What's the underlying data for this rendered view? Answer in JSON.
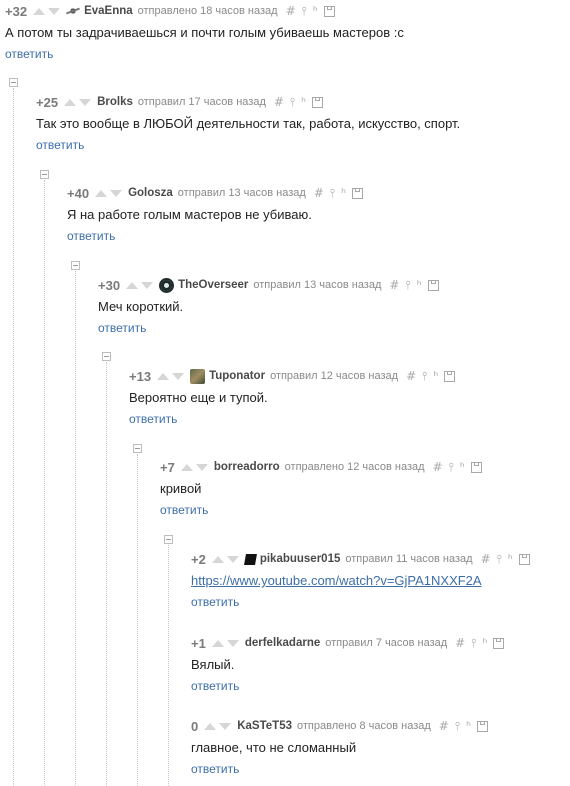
{
  "comments": [
    {
      "rating": "+32",
      "user": "EvaEnna",
      "time": "отправлено 18 часов назад",
      "text": "А потом ты задрачиваешься и почти голым убиваешь мастеров :с",
      "reply": "ответить",
      "avatar": "bug-avatar"
    },
    {
      "rating": "+25",
      "user": "Brolks",
      "time": "отправил 17 часов назад",
      "text": "Так это вообще в ЛЮБОЙ деятельности так, работа, искусство, спорт.",
      "reply": "ответить",
      "avatar": ""
    },
    {
      "rating": "+40",
      "user": "Golosza",
      "time": "отправил 13 часов назад",
      "text": "Я на работе голым мастеров не убиваю.",
      "reply": "ответить",
      "avatar": ""
    },
    {
      "rating": "+30",
      "user": "TheOverseer",
      "time": "отправил 13 часов назад",
      "text": "Меч короткий.",
      "reply": "ответить",
      "avatar": "ring-avatar"
    },
    {
      "rating": "+13",
      "user": "Tuponator",
      "time": "отправил 12 часов назад",
      "text": "Вероятно еще и тупой.",
      "reply": "ответить",
      "avatar": "photo-avatar"
    },
    {
      "rating": "+7",
      "user": "borreadorro",
      "time": "отправлено 12 часов назад",
      "text": "кривой",
      "reply": "ответить",
      "avatar": ""
    },
    {
      "rating": "+2",
      "user": "pikabuuser015",
      "time": "отправил 11 часов назад",
      "text": "https://www.youtube.com/watch?v=GjPA1NXXF2A",
      "reply": "ответить",
      "avatar": "dark-avatar",
      "is_link": true
    },
    {
      "rating": "+1",
      "user": "derfelkadarne",
      "time": "отправил 7 часов назад",
      "text": "Вялый.",
      "reply": "ответить",
      "avatar": ""
    },
    {
      "rating": "0",
      "user": "KaSTeT53",
      "time": "отправлено 8 часов назад",
      "text": "главное, что не сломанный",
      "reply": "ответить",
      "avatar": ""
    }
  ],
  "action_icons": {
    "hash": "#",
    "pin": "⫯",
    "branch": "ʰ",
    "save": "save-icon"
  },
  "colors": {
    "link": "#3c6ea8",
    "rating": "#7a7a7a",
    "meta": "#8a8a8a",
    "thread_line": "#c8c8c8"
  }
}
